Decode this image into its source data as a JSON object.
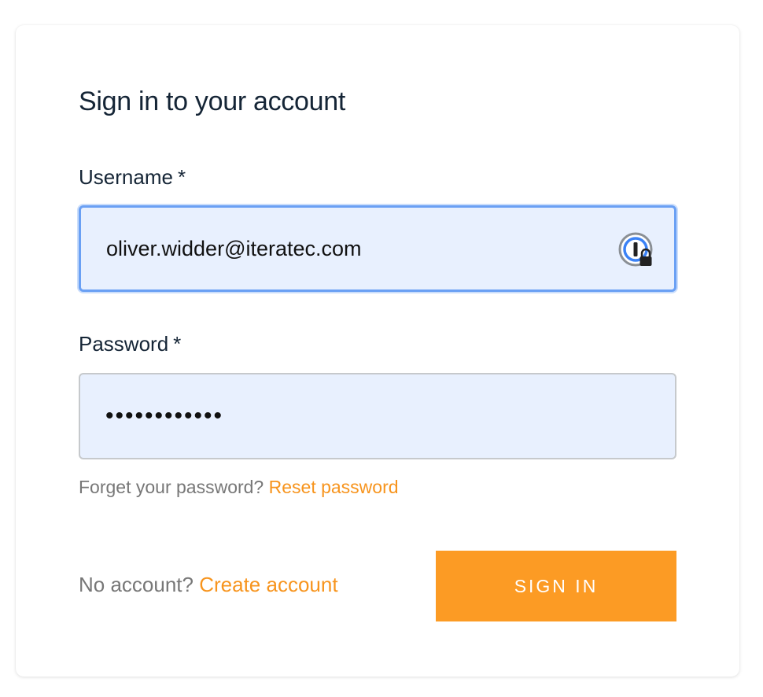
{
  "form": {
    "title": "Sign in to your account",
    "username": {
      "label": "Username",
      "required_marker": "*",
      "value": "oliver.widder@iteratec.com",
      "icon": "password-manager-icon"
    },
    "password": {
      "label": "Password",
      "required_marker": "*",
      "masked_value": "••••••••••••"
    },
    "forgot": {
      "text": "Forget your password?",
      "link_label": "Reset password"
    },
    "no_account": {
      "text": "No account?",
      "link_label": "Create account"
    },
    "submit_label": "SIGN IN"
  },
  "colors": {
    "accent": "#fc9b24",
    "link": "#f7941d",
    "focus_border": "#6aa0f4",
    "autofill_bg": "#e8f0fe",
    "heading": "#152536",
    "muted": "#777777"
  }
}
